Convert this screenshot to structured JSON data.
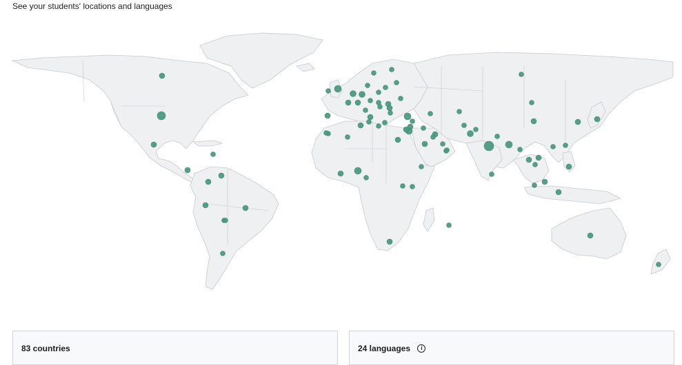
{
  "header": {
    "subtitle": "See your students' locations and languages"
  },
  "map": {
    "land_color": "#eff0f2",
    "border_color": "#c8c9cd",
    "dot_color": "#4c9a82",
    "markers": [
      {
        "name": "canada",
        "r": 4
      },
      {
        "name": "usa",
        "r": 6
      },
      {
        "name": "mexico",
        "r": 4
      },
      {
        "name": "cuba",
        "r": 3.5
      },
      {
        "name": "costa-rica",
        "r": 4
      },
      {
        "name": "colombia",
        "r": 4
      },
      {
        "name": "venezuela",
        "r": 4
      },
      {
        "name": "ecuador",
        "r": 4
      },
      {
        "name": "peru",
        "r": 3.5
      },
      {
        "name": "brazil",
        "r": 4
      },
      {
        "name": "bolivia",
        "r": 3.5
      },
      {
        "name": "chile",
        "r": 3.5
      },
      {
        "name": "ireland",
        "r": 3.5
      },
      {
        "name": "uk",
        "r": 5
      },
      {
        "name": "norway",
        "r": 3.5
      },
      {
        "name": "sweden",
        "r": 3.5
      },
      {
        "name": "finland",
        "r": 3.5
      },
      {
        "name": "netherlands",
        "r": 4.5
      },
      {
        "name": "belgium",
        "r": 4
      },
      {
        "name": "denmark",
        "r": 3.5
      },
      {
        "name": "germany",
        "r": 4.5
      },
      {
        "name": "poland",
        "r": 3.5
      },
      {
        "name": "latvia",
        "r": 3.5
      },
      {
        "name": "france",
        "r": 4
      },
      {
        "name": "switzerland",
        "r": 3.5
      },
      {
        "name": "austria",
        "r": 3.5
      },
      {
        "name": "czech",
        "r": 3.5
      },
      {
        "name": "hungary",
        "r": 4
      },
      {
        "name": "romania",
        "r": 4
      },
      {
        "name": "ukraine",
        "r": 3.5
      },
      {
        "name": "serbia",
        "r": 3.5
      },
      {
        "name": "bulgaria",
        "r": 3.5
      },
      {
        "name": "italy",
        "r": 4
      },
      {
        "name": "spain",
        "r": 4
      },
      {
        "name": "portugal",
        "r": 3.5
      },
      {
        "name": "greece",
        "r": 3.5
      },
      {
        "name": "turkey",
        "r": 5
      },
      {
        "name": "georgia",
        "r": 3.5
      },
      {
        "name": "morocco",
        "r": 4
      },
      {
        "name": "algeria",
        "r": 3.5
      },
      {
        "name": "tunisia",
        "r": 3.5
      },
      {
        "name": "libya",
        "r": 3.5
      },
      {
        "name": "egypt",
        "r": 5
      },
      {
        "name": "israel",
        "r": 4
      },
      {
        "name": "lebanon",
        "r": 3.5
      },
      {
        "name": "jordan",
        "r": 4
      },
      {
        "name": "iraq",
        "r": 3.5
      },
      {
        "name": "iran",
        "r": 4
      },
      {
        "name": "saudi-arabia",
        "r": 4
      },
      {
        "name": "uae",
        "r": 3.5
      },
      {
        "name": "kuwait",
        "r": 3.5
      },
      {
        "name": "kazakhstan",
        "r": 3.5
      },
      {
        "name": "uzbekistan",
        "r": 3.5
      },
      {
        "name": "afghanistan",
        "r": 3.5
      },
      {
        "name": "pakistan",
        "r": 4.5
      },
      {
        "name": "india",
        "r": 7
      },
      {
        "name": "nepal",
        "r": 3.5
      },
      {
        "name": "bangladesh",
        "r": 5
      },
      {
        "name": "myanmar",
        "r": 3.5
      },
      {
        "name": "thailand",
        "r": 4
      },
      {
        "name": "vietnam",
        "r": 4
      },
      {
        "name": "cambodia",
        "r": 3.5
      },
      {
        "name": "malaysia",
        "r": 4
      },
      {
        "name": "singapore",
        "r": 3.5
      },
      {
        "name": "indonesia",
        "r": 4
      },
      {
        "name": "philippines",
        "r": 4
      },
      {
        "name": "china",
        "r": 4
      },
      {
        "name": "mongolia",
        "r": 3.5
      },
      {
        "name": "russia",
        "r": 3.5
      },
      {
        "name": "korea",
        "r": 4
      },
      {
        "name": "japan",
        "r": 4
      },
      {
        "name": "taiwan",
        "r": 3.5
      },
      {
        "name": "hong-kong",
        "r": 3.5
      },
      {
        "name": "sri-lanka",
        "r": 3.5
      },
      {
        "name": "nigeria",
        "r": 5
      },
      {
        "name": "ghana",
        "r": 4
      },
      {
        "name": "senegal",
        "r": 3.5
      },
      {
        "name": "cameroon",
        "r": 3.5
      },
      {
        "name": "ethiopia",
        "r": 3.5
      },
      {
        "name": "kenya",
        "r": 3.5
      },
      {
        "name": "uganda",
        "r": 3.5
      },
      {
        "name": "south-africa",
        "r": 4
      },
      {
        "name": "mauritius",
        "r": 3.5
      },
      {
        "name": "australia",
        "r": 4
      },
      {
        "name": "new-zealand",
        "r": 3.5
      },
      {
        "name": "sudan",
        "r": 4
      },
      {
        "name": "yemen",
        "r": 3.5
      },
      {
        "name": "oman",
        "r": 3.5
      }
    ]
  },
  "cards": {
    "countries_label": "83 countries",
    "languages_label": "24 languages"
  }
}
